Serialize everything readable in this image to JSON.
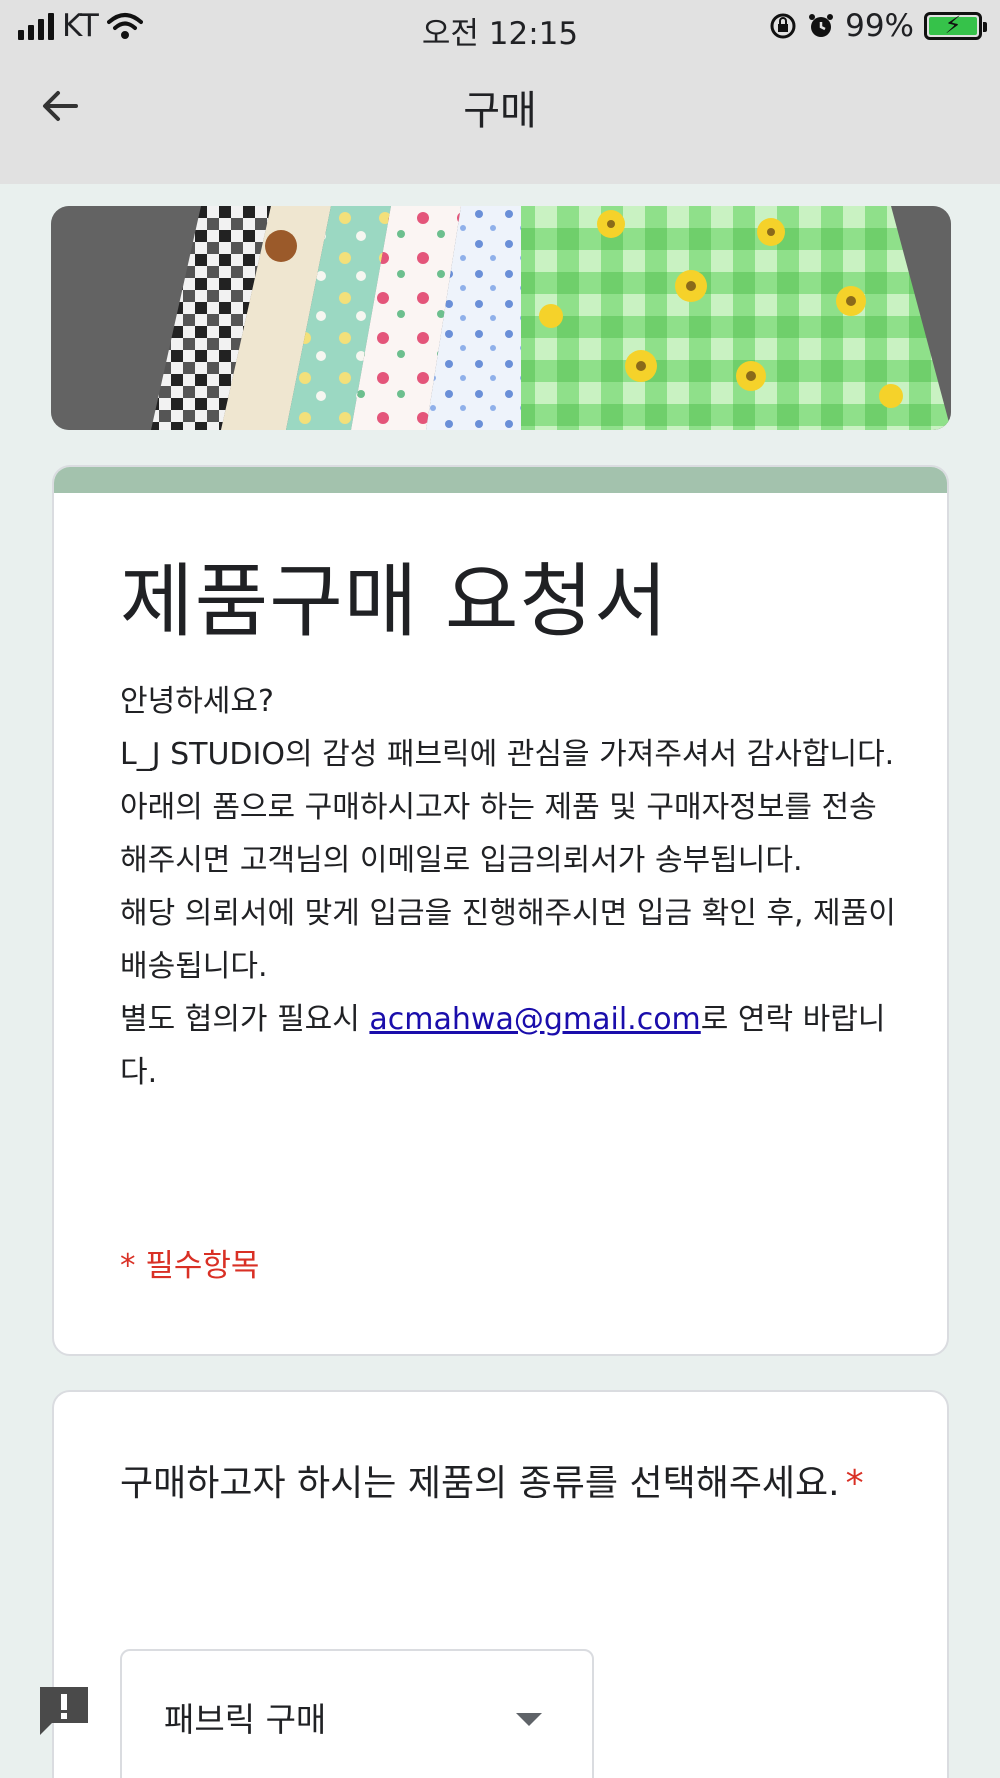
{
  "status_bar": {
    "carrier": "KT",
    "time": "오전 12:15",
    "battery": "99%"
  },
  "appbar": {
    "title": "구매"
  },
  "form": {
    "title": "제품구매 요청서",
    "description": {
      "line1": "안녕하세요?",
      "line2": "L_J STUDIO의 감성 패브릭에 관심을 가져주셔서 감사합니다.",
      "line3": "아래의 폼으로 구매하시고자 하는 제품 및 구매자정보를 전송해주시면 고객님의 이메일로 입금의뢰서가 송부됩니다.",
      "line4": "해당 의뢰서에 맞게 입금을 진행해주시면 입금 확인 후, 제품이 배송됩니다.",
      "line5_before": "별도 협의가 필요시 ",
      "email": "acmahwa@gmail.com",
      "line5_after": "로 연락 바랍니다."
    },
    "required_note": "* 필수항목"
  },
  "question": {
    "text": "구매하고자 하시는 제품의 종류를 선택해주세요.",
    "required_mark": "*",
    "selected_value": "패브릭 구매"
  },
  "colors": {
    "accent_bar": "#a3c2ad",
    "background": "#e9f0ee",
    "required": "#d93025",
    "link": "#1a0dab"
  },
  "icons": [
    "signal-icon",
    "wifi-icon",
    "rotation-lock-icon",
    "alarm-icon",
    "battery-icon",
    "back-arrow-icon",
    "dropdown-arrow-icon",
    "feedback-icon"
  ]
}
